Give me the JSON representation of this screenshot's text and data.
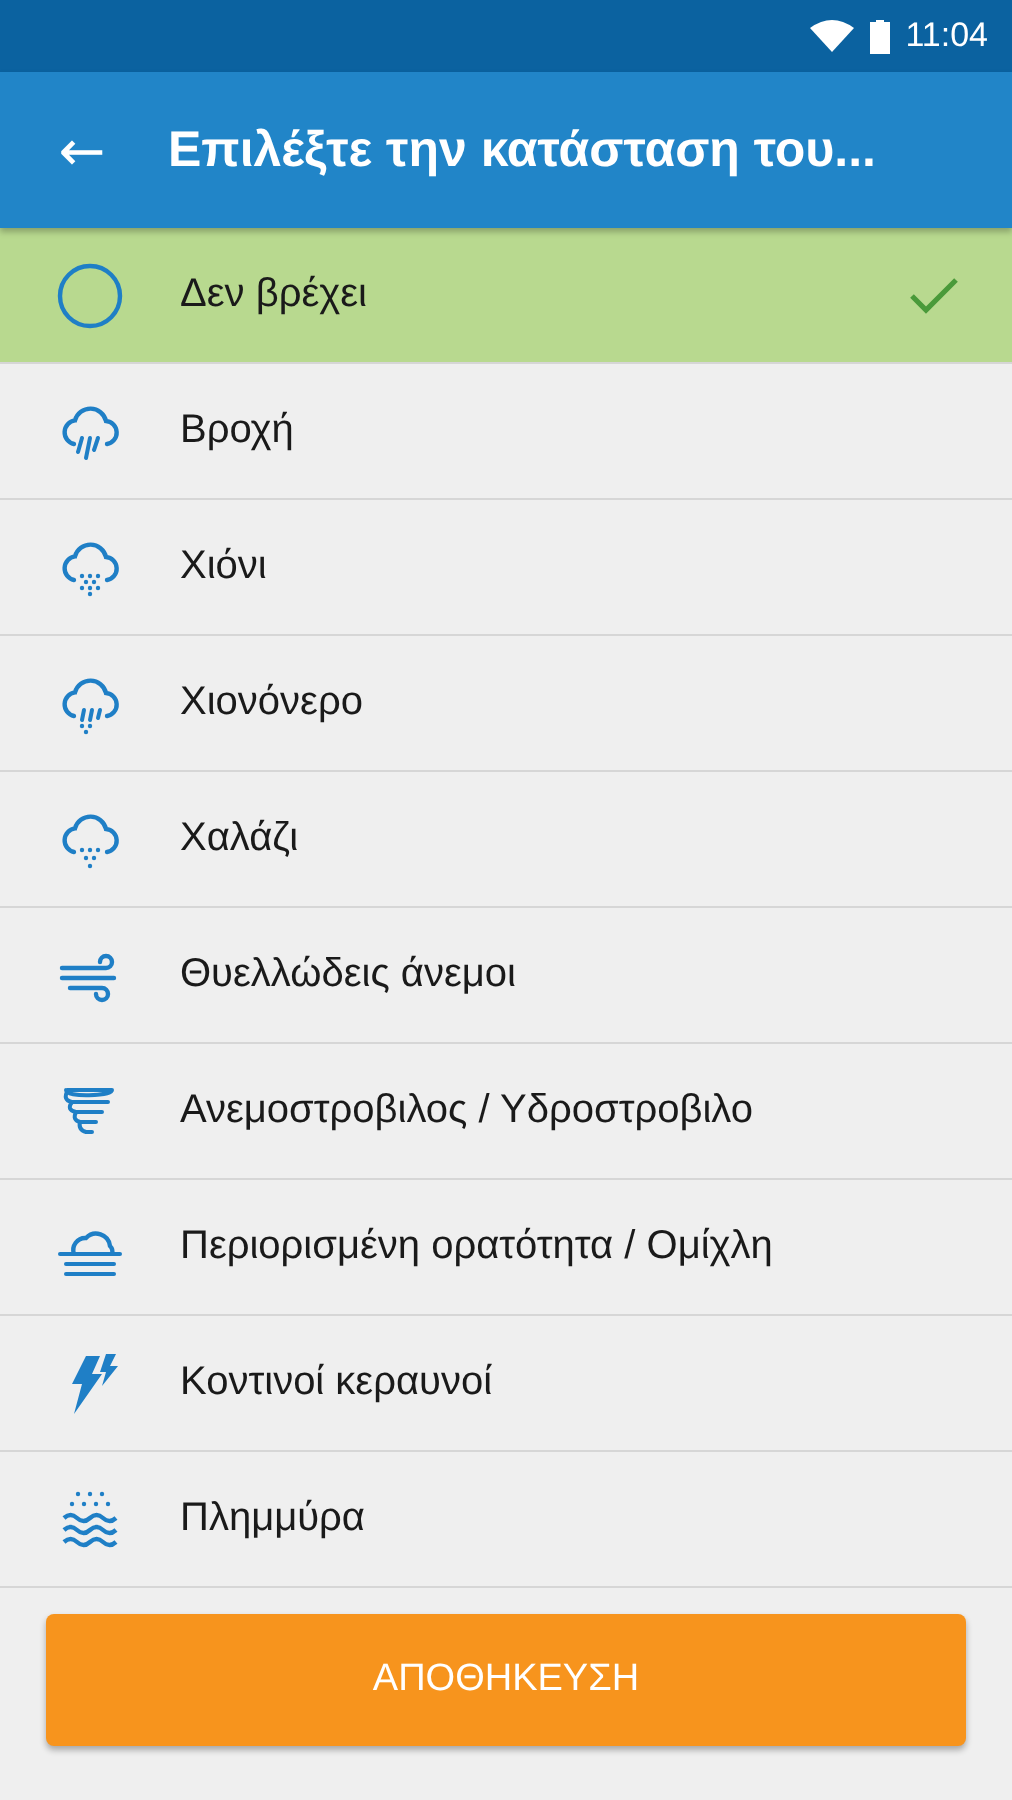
{
  "status_bar": {
    "time": "11:04"
  },
  "app_bar": {
    "back": "←",
    "title": "Επιλέξτε την κατάσταση του..."
  },
  "items": [
    {
      "label": "Δεν βρέχει",
      "kind": "circle",
      "selected": true
    },
    {
      "label": "Βροχή",
      "kind": "rain",
      "selected": false
    },
    {
      "label": "Χιόνι",
      "kind": "snow",
      "selected": false
    },
    {
      "label": "Χιονόνερο",
      "kind": "sleet",
      "selected": false
    },
    {
      "label": "Χαλάζι",
      "kind": "hail",
      "selected": false
    },
    {
      "label": "Θυελλώδεις άνεμοι",
      "kind": "wind",
      "selected": false
    },
    {
      "label": "Ανεμοστροβιλος / Υδροστροβιλο",
      "kind": "tornado",
      "selected": false
    },
    {
      "label": "Περιορισμένη ορατότητα / Ομίχλη",
      "kind": "fog",
      "selected": false
    },
    {
      "label": "Κοντινοί κεραυνοί",
      "kind": "lightning",
      "selected": false
    },
    {
      "label": "Πλημμύρα",
      "kind": "flood",
      "selected": false
    }
  ],
  "save_button": "ΑΠΟΘΗΚΕΥΣΗ"
}
